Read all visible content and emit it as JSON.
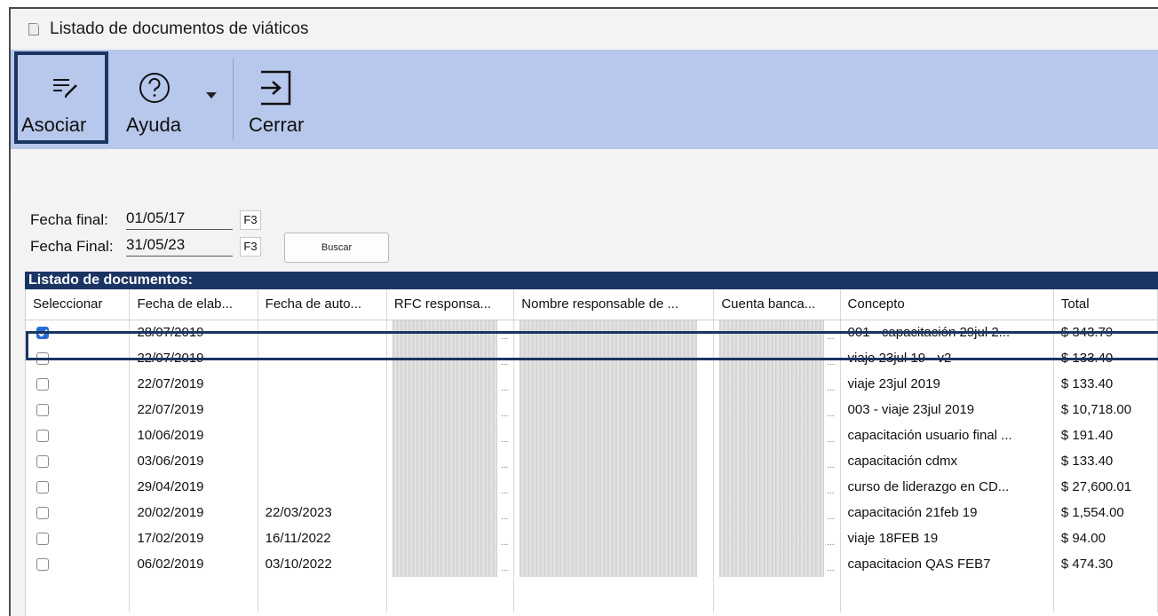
{
  "window": {
    "title": "Listado de documentos de viáticos"
  },
  "ribbon": {
    "asociar_label": "Asociar",
    "ayuda_label": "Ayuda",
    "cerrar_label": "Cerrar"
  },
  "filters": {
    "fecha_inicial_label": "Fecha final:",
    "fecha_inicial_value": "01/05/17",
    "fecha_final_label": "Fecha Final:",
    "fecha_final_value": "31/05/23",
    "key_label": "F3",
    "buscar_label": "Buscar"
  },
  "list": {
    "title": "Listado de documentos:",
    "columns": [
      "Seleccionar",
      "Fecha de elab...",
      "Fecha de auto...",
      "RFC responsa...",
      "Nombre responsable de ...",
      "Cuenta banca...",
      "Concepto",
      "Total"
    ],
    "rows": [
      {
        "selected": true,
        "fecha_elab": "28/07/2019",
        "fecha_auto": "",
        "concepto": "001 - capacitación 29jul 2...",
        "total": "$ 343.79"
      },
      {
        "selected": false,
        "fecha_elab": "22/07/2019",
        "fecha_auto": "",
        "concepto": "viaje 23jul 19 - v2",
        "total": "$ 133.40"
      },
      {
        "selected": false,
        "fecha_elab": "22/07/2019",
        "fecha_auto": "",
        "concepto": "viaje 23jul 2019",
        "total": "$ 133.40"
      },
      {
        "selected": false,
        "fecha_elab": "22/07/2019",
        "fecha_auto": "",
        "concepto": "003 - viaje 23jul 2019",
        "total": "$ 10,718.00"
      },
      {
        "selected": false,
        "fecha_elab": "10/06/2019",
        "fecha_auto": "",
        "concepto": "capacitación usuario final ...",
        "total": "$ 191.40"
      },
      {
        "selected": false,
        "fecha_elab": "03/06/2019",
        "fecha_auto": "",
        "concepto": "capacitación cdmx",
        "total": "$ 133.40"
      },
      {
        "selected": false,
        "fecha_elab": "29/04/2019",
        "fecha_auto": "",
        "concepto": "curso de liderazgo en CD...",
        "total": "$ 27,600.01"
      },
      {
        "selected": false,
        "fecha_elab": "20/02/2019",
        "fecha_auto": "22/03/2023",
        "concepto": "capacitación 21feb 19",
        "total": "$ 1,554.00"
      },
      {
        "selected": false,
        "fecha_elab": "17/02/2019",
        "fecha_auto": "16/11/2022",
        "concepto": "viaje 18FEB 19",
        "total": "$ 94.00"
      },
      {
        "selected": false,
        "fecha_elab": "06/02/2019",
        "fecha_auto": "03/10/2022",
        "concepto": "capacitacion QAS FEB7",
        "total": "$ 474.30"
      }
    ],
    "truncation": "..."
  },
  "colors": {
    "ribbon": "#b7c8ec",
    "accent": "#1a3563",
    "check": "#2a6cd6"
  },
  "icons": {
    "asociar": "list-edit-icon",
    "ayuda": "help-circle-icon",
    "cerrar": "exit-arrow-icon"
  }
}
